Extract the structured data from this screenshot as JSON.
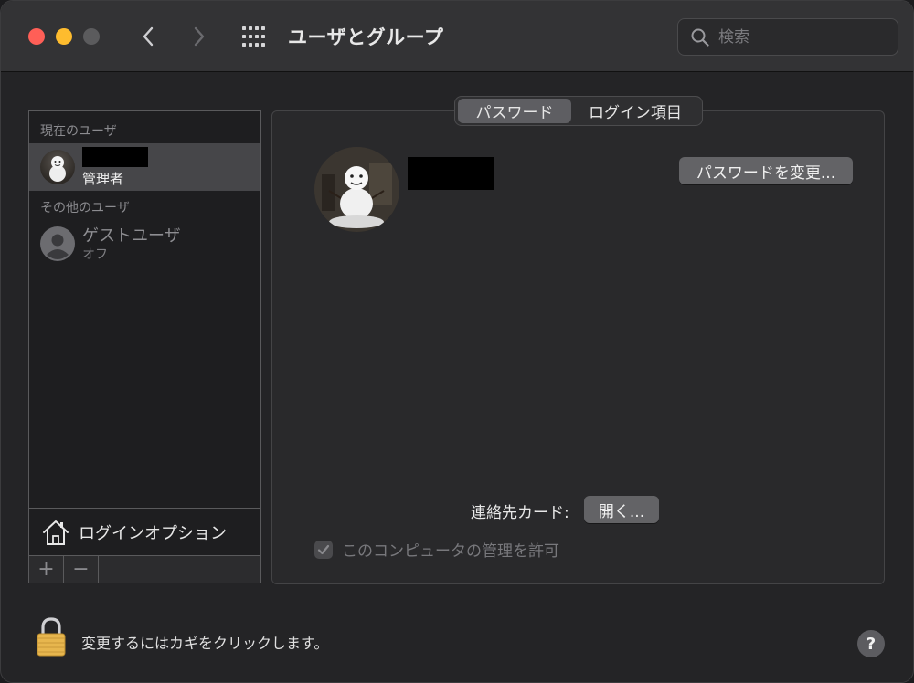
{
  "window": {
    "title": "ユーザとグループ",
    "search_placeholder": "検索"
  },
  "sidebar": {
    "current_users_label": "現在のユーザ",
    "current_user": {
      "role": "管理者"
    },
    "other_users_label": "その他のユーザ",
    "guest": {
      "name": "ゲストユーザ",
      "status": "オフ"
    },
    "login_options_label": "ログインオプション",
    "add_label": "+",
    "remove_label": "−"
  },
  "tabs": [
    {
      "label": "パスワード",
      "active": true
    },
    {
      "label": "ログイン項目",
      "active": false
    }
  ],
  "main": {
    "change_password_label": "パスワードを変更...",
    "contact_card_label": "連絡先カード:",
    "open_label": "開く...",
    "allow_admin_label": "このコンピュータの管理を許可",
    "allow_admin_checked": true
  },
  "footer": {
    "lock_text": "変更するにはカギをクリックします。",
    "help_label": "?"
  },
  "colors": {
    "close": "#ff5f57",
    "minimize": "#febc2e",
    "selected_row": "#464649",
    "button": "#636366"
  },
  "icons": {
    "back": "chevron-left-icon",
    "forward": "chevron-right-icon",
    "grid": "grid-icon",
    "search": "search-icon",
    "house": "house-icon",
    "lock": "lock-icon",
    "guest": "person-icon"
  }
}
